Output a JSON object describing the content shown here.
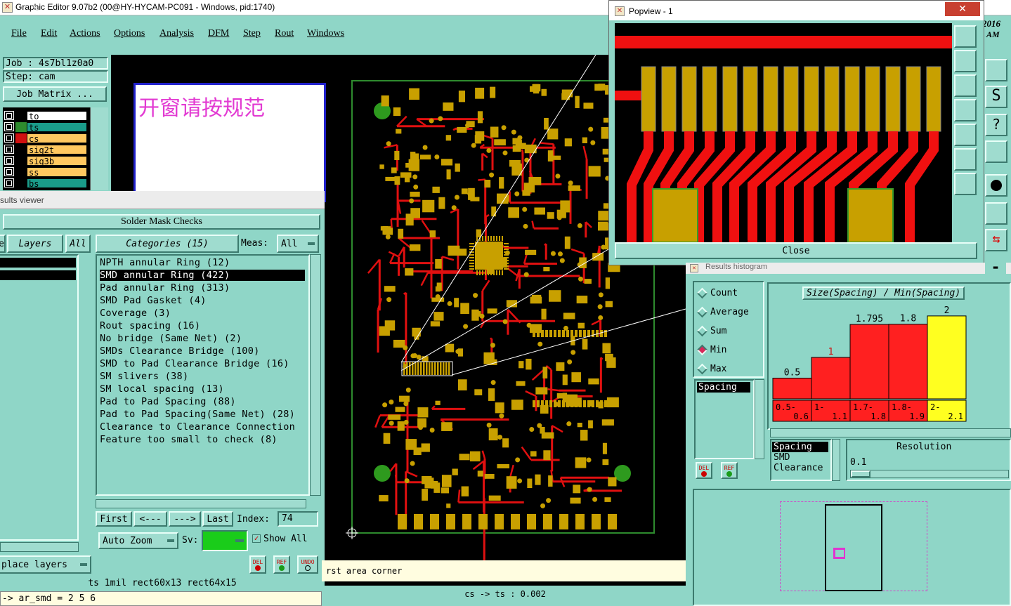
{
  "app": {
    "title": "Graphic Editor 9.07b2 (00@HY-HYCAM-PC091 - Windows, pid:1740)",
    "menu": [
      "File",
      "Edit",
      "Actions",
      "Options",
      "Analysis",
      "DFM",
      "Step",
      "Rout",
      "Windows"
    ]
  },
  "job": {
    "job_label": "Job : 4s7bl1z0a0",
    "step_label": "Step: cam",
    "matrix_button": "Job Matrix ..."
  },
  "layers": [
    {
      "name": "to",
      "color": "#000000",
      "box": "#ffffff"
    },
    {
      "name": "ts",
      "color": "#2e8b2e",
      "box": "#1a9c8a"
    },
    {
      "name": "cs",
      "color": "#d01010",
      "box": "#ffc860"
    },
    {
      "name": "sig2t",
      "color": "#000000",
      "box": "#ffc860"
    },
    {
      "name": "sig3b",
      "color": "#000000",
      "box": "#ffc860"
    },
    {
      "name": "ss",
      "color": "#000000",
      "box": "#ffc860"
    },
    {
      "name": "bs",
      "color": "#000000",
      "box": "#1a9c8a"
    }
  ],
  "note_text": "开窗请按规范",
  "results_viewer": {
    "window_title": "sults viewer",
    "panel_title": "Solder Mask Checks",
    "layers_tab": "Layers",
    "all_tab": "All",
    "categories_tab": "Categories (15)",
    "meas_label": "Meas:",
    "meas_value": "All",
    "categories": [
      "NPTH annular Ring (12)",
      "SMD annular Ring (422)",
      "Pad annular Ring (313)",
      "SMD Pad Gasket (4)",
      "Coverage (3)",
      "Rout spacing (16)",
      "No bridge (Same Net) (2)",
      "SMDs Clearance Bridge (100)",
      "SMD to Pad Clearance Bridge (16)",
      "SM slivers (38)",
      "SM local spacing (13)",
      "Pad to Pad Spacing (88)",
      "Pad to Pad Spacing(Same Net) (28)",
      "Clearance to Clearance Connection",
      "Feature too small to check (8)"
    ],
    "selected_index": 1,
    "nav": {
      "first": "First",
      "prev": "<---",
      "next": "--->",
      "last": "Last",
      "index_label": "Index:",
      "index_value": "74"
    },
    "zoom": "Auto Zoom",
    "sv_label": "Sv:",
    "show_all": "Show All",
    "place_layers": "place layers",
    "del": "DEL",
    "ref": "REF",
    "undo": "UNDO"
  },
  "status": {
    "info": "ts 1mil  rect60x13  rect64x15",
    "command": "-> ar_smd = 2 5 6",
    "prompt": "rst area corner",
    "measure": "cs -> ts : 0.002"
  },
  "clock": {
    "year": "2016",
    "ampm": "AM"
  },
  "popview": {
    "title": "Popview - 1",
    "close": "Close"
  },
  "histogram": {
    "window_title": "Results histogram",
    "modes": [
      "Count",
      "Average",
      "Sum",
      "Min",
      "Max"
    ],
    "selected_mode": "Min",
    "chart_title": "Size(Spacing) / Min(Spacing)",
    "list1": [
      "Spacing"
    ],
    "list2": [
      "Spacing",
      "SMD",
      "Clearance"
    ],
    "resolution_label": "Resolution",
    "resolution_value": "0.1",
    "del": "DEL",
    "ref": "REF"
  },
  "chart_data": {
    "type": "bar",
    "title": "Size(Spacing) / Min(Spacing)",
    "categories": [
      "0.5-0.6",
      "1-1.1",
      "1.7-1.8",
      "1.8-1.9",
      "2-2.1"
    ],
    "values": [
      0.5,
      1,
      1.795,
      1.8,
      2
    ],
    "value_labels": [
      "0.5",
      "1",
      "1.795",
      "1.8",
      "2"
    ],
    "bin_labels": [
      [
        "0.5-",
        "0.6"
      ],
      [
        "1-",
        "1.1"
      ],
      [
        "1.7-",
        "1.8"
      ],
      [
        "1.8-",
        "1.9"
      ],
      [
        "2-",
        "2.1"
      ]
    ],
    "colors": [
      "#ff2020",
      "#ff2020",
      "#ff2020",
      "#ff2020",
      "#ffff20"
    ],
    "ylim": [
      0,
      2.1
    ]
  }
}
